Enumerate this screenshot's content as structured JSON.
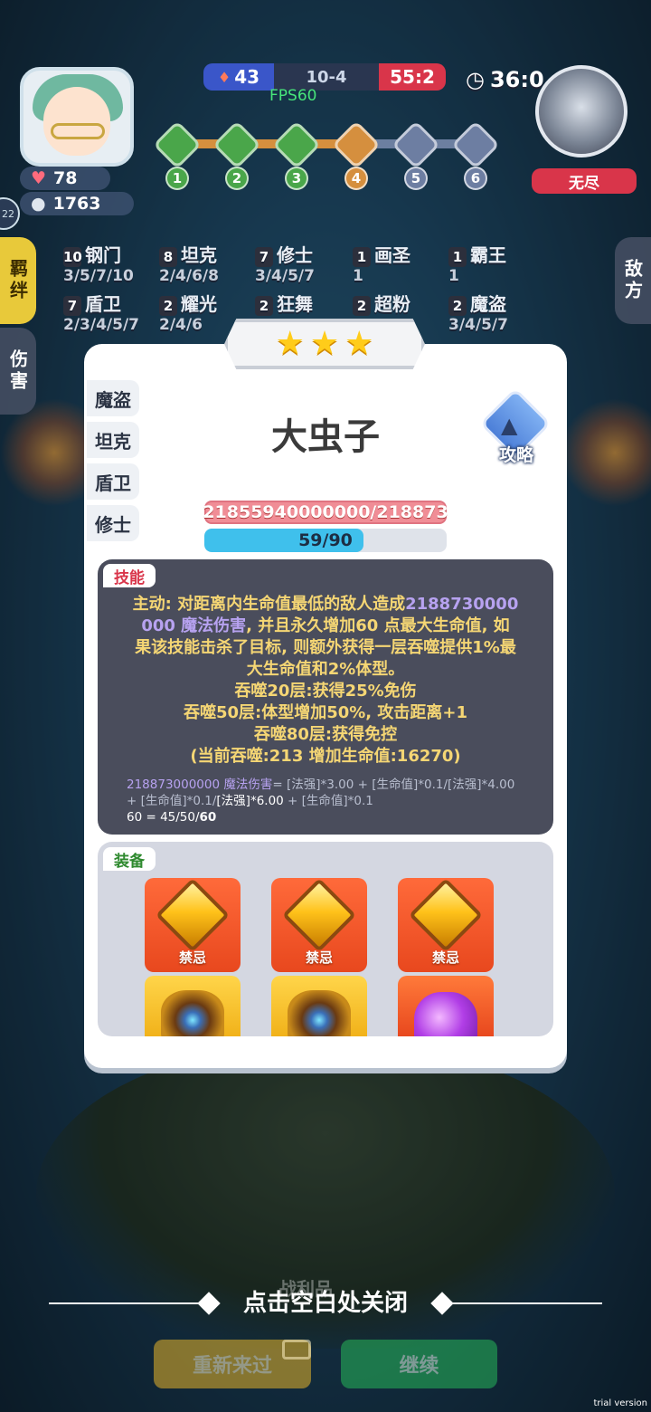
{
  "hud": {
    "player_hp": "78",
    "player_gold": "1763",
    "blue_score": "43",
    "round": "10-4",
    "red_score": "55:2",
    "fps": "FPS60",
    "timer": "36:0",
    "enemy_label": "无尽",
    "stages": [
      "1",
      "2",
      "3",
      "4",
      "5",
      "6"
    ],
    "left_edge_number": "22"
  },
  "side_tabs": {
    "left": [
      "羁绊",
      "伤害"
    ],
    "right": [
      "敌方"
    ]
  },
  "synergies": [
    {
      "count": "10",
      "name": "钢门",
      "levels": "3/5/7/10"
    },
    {
      "count": "8",
      "name": "坦克",
      "levels": "2/4/6/8"
    },
    {
      "count": "7",
      "name": "修士",
      "levels": "3/4/5/7"
    },
    {
      "count": "1",
      "name": "画圣",
      "levels": "1"
    },
    {
      "count": "1",
      "name": "霸王",
      "levels": "1"
    },
    {
      "count": "7",
      "name": "盾卫",
      "levels": "2/3/4/5/7"
    },
    {
      "count": "2",
      "name": "耀光",
      "levels": "2/4/6"
    },
    {
      "count": "2",
      "name": "狂舞",
      "levels": ""
    },
    {
      "count": "2",
      "name": "超粉",
      "levels": ""
    },
    {
      "count": "2",
      "name": "魔盗",
      "levels": "3/4/5/7"
    }
  ],
  "modal": {
    "stars": 3,
    "tabs": [
      "魔盗",
      "坦克",
      "盾卫",
      "修士"
    ],
    "unit_name": "大虫子",
    "guide_label": "攻略",
    "hp_text": "21855940000000/218873",
    "mana_text": "59/90",
    "mana_fraction": 0.656,
    "skill_tag": "技能",
    "skill_lines": {
      "l1a": "主动: 对距离内生命值最低的敌人造成",
      "l1b": "2188730000",
      "l2a": "000 魔法伤害",
      "l2b": ", 并且永久增加60 点最大生命值, 如",
      "l3": "果该技能击杀了目标, 则额外获得一层吞噬提供1%最",
      "l4": "大生命值和2%体型。",
      "l5": "吞噬20层:获得25%免伤",
      "l6": "吞噬50层:体型增加50%, 攻击距离+1",
      "l7": "吞噬80层:获得免控",
      "l8": "(当前吞噬:213 增加生命值:16270)"
    },
    "formula": {
      "f1a": "218873000000 魔法伤害",
      "f1b": "= [法强]*3.00 + [生命值]*0.1/[法强]*4.00",
      "f2a": "+ [生命值]*0.1/",
      "f2b": "[法强]*6.00",
      "f2c": " + [生命值]*0.1",
      "f3a": "60 = 45/50/",
      "f3b": "60"
    },
    "equip_tag": "装备",
    "equipment": [
      {
        "label": "禁忌"
      },
      {
        "label": "禁忌"
      },
      {
        "label": "禁忌"
      }
    ]
  },
  "footer": {
    "behind_label": "战利品",
    "close_hint": "点击空白处关闭",
    "retry_button": "重新来过",
    "continue_button": "继续",
    "watermark": "trial version"
  },
  "colors": {
    "accent_red": "#d9354a",
    "accent_blue": "#3a56c9",
    "skill_text": "#f5d674",
    "magic_text": "#b7a2f0"
  }
}
